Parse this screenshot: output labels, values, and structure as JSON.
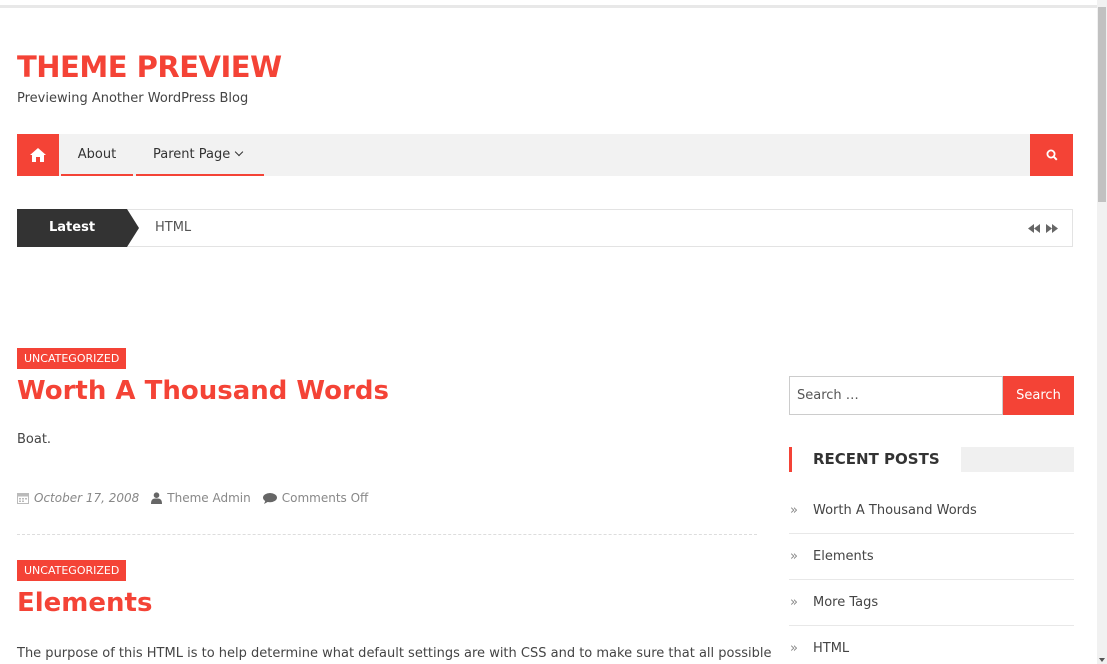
{
  "site": {
    "title": "THEME PREVIEW",
    "description": "Previewing Another WordPress Blog"
  },
  "nav": {
    "home_icon": "home-icon",
    "items": [
      {
        "label": "About"
      },
      {
        "label": "Parent Page"
      }
    ],
    "search_icon": "search-icon"
  },
  "ticker": {
    "label": "Latest",
    "text": "HTML",
    "prev_icon": "backward-icon",
    "next_icon": "forward-icon"
  },
  "posts": [
    {
      "category": "UNCATEGORIZED",
      "title": "Worth A Thousand Words",
      "excerpt": "Boat.",
      "date": "October 17, 2008",
      "author": "Theme Admin",
      "comments": "Comments Off"
    },
    {
      "category": "UNCATEGORIZED",
      "title": "Elements",
      "excerpt": "The purpose of this HTML is to help determine what default settings are with CSS and to make sure that all possible"
    }
  ],
  "sidebar": {
    "search": {
      "placeholder": "Search …",
      "button": "Search"
    },
    "recent_posts": {
      "title": "RECENT POSTS",
      "items": [
        "Worth A Thousand Words",
        "Elements",
        "More Tags",
        "HTML"
      ]
    }
  },
  "colors": {
    "accent": "#f44336",
    "dark": "#333333"
  }
}
